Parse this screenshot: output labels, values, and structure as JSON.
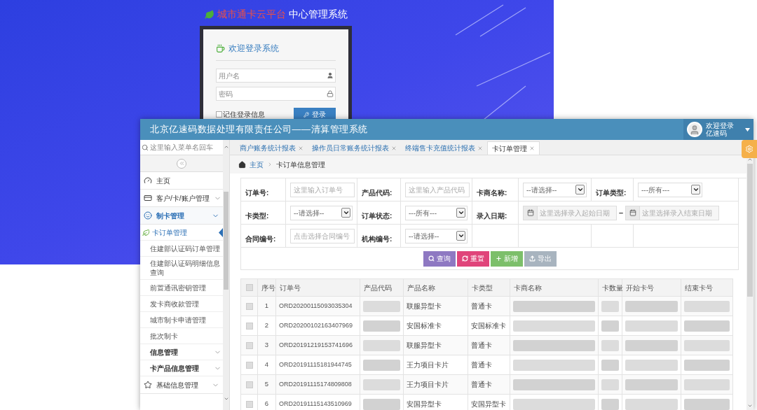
{
  "login_screen": {
    "brand": "城市通卡云平台",
    "system_name": "中心管理系统",
    "card_title": "欢迎登录系统",
    "username": {
      "placeholder": "用户名"
    },
    "password": {
      "placeholder": "密码"
    },
    "remember": {
      "label": "记住登录信息",
      "checked": false
    },
    "login_button": "登录"
  },
  "window": {
    "title": "北京亿速码数据处理有限责任公司——清算管理系统",
    "user": {
      "greeting": "欢迎登录",
      "name": "亿速码"
    }
  },
  "sidebar": {
    "search": {
      "placeholder": "这里输入菜单名回车"
    },
    "items": [
      {
        "label": "主页",
        "kind": "link",
        "selected": false
      },
      {
        "label": "客户/卡/账户管理",
        "kind": "group",
        "expanded": false
      },
      {
        "label": "制卡管理",
        "kind": "group",
        "expanded": true,
        "children": [
          {
            "label": "卡订单管理",
            "kind": "link",
            "selected": true
          },
          {
            "label": "住建部认证码订单管理",
            "kind": "link",
            "selected": false
          },
          {
            "label": "住建部认证码明细信息查询",
            "kind": "link",
            "selected": false
          },
          {
            "label": "前置通讯密钥管理",
            "kind": "link",
            "selected": false
          },
          {
            "label": "发卡商收款管理",
            "kind": "link",
            "selected": false
          },
          {
            "label": "城市制卡申请管理",
            "kind": "link",
            "selected": false
          },
          {
            "label": "批次制卡",
            "kind": "link",
            "selected": false
          },
          {
            "label": "信息管理",
            "kind": "group",
            "expanded": false
          },
          {
            "label": "卡产品信息管理",
            "kind": "group",
            "expanded": false
          }
        ]
      },
      {
        "label": "基础信息管理",
        "kind": "group",
        "expanded": false
      }
    ]
  },
  "tabs": [
    {
      "label": "商户账务统计报表",
      "selected": false
    },
    {
      "label": "操作员日常账务统计报表",
      "selected": false
    },
    {
      "label": "终端售卡充值统计报表",
      "selected": false
    },
    {
      "label": "卡订单管理",
      "selected": true
    }
  ],
  "breadcrumb": [
    "主页",
    "卡订单信息管理"
  ],
  "filter_form": {
    "rows": [
      [
        {
          "label": "订单号:",
          "kind": "text",
          "placeholder": "这里输入订单号"
        },
        {
          "label": "产品代码:",
          "kind": "text",
          "placeholder": "这里输入产品代码"
        },
        {
          "label": "卡商名称:",
          "kind": "select",
          "value": "--请选择--"
        },
        {
          "label": "订单类型:",
          "kind": "select",
          "value": "---所有---"
        }
      ],
      [
        {
          "label": "卡类型:",
          "kind": "select",
          "value": "--请选择--"
        },
        {
          "label": "订单状态:",
          "kind": "select",
          "value": "---所有---"
        },
        {
          "label": "录入日期:",
          "kind": "daterange",
          "start_placeholder": "这里选择录入起始日期",
          "separator": "–",
          "end_placeholder": "这里选择录入结束日期"
        }
      ],
      [
        {
          "label": "合同编号:",
          "kind": "text",
          "placeholder": "点击选择合同编号"
        },
        {
          "label": "机构编号:",
          "kind": "select",
          "value": "--请选择--"
        }
      ]
    ],
    "buttons": [
      {
        "label": "查询",
        "kind": "search",
        "disabled": false
      },
      {
        "label": "重置",
        "kind": "reset",
        "disabled": false
      },
      {
        "label": "新增",
        "kind": "add",
        "disabled": false
      },
      {
        "label": "导出",
        "kind": "export",
        "disabled": true
      }
    ]
  },
  "table": {
    "columns": [
      {
        "label": "序号",
        "kind": "number"
      },
      {
        "label": "订单号",
        "kind": "code"
      },
      {
        "label": "产品代码",
        "kind": "redacted"
      },
      {
        "label": "产品名称",
        "kind": "text"
      },
      {
        "label": "卡类型",
        "kind": "text"
      },
      {
        "label": "卡商名称",
        "kind": "redacted"
      },
      {
        "label": "卡数量",
        "kind": "redacted"
      },
      {
        "label": "开始卡号",
        "kind": "redacted"
      },
      {
        "label": "结束卡号",
        "kind": "redacted"
      }
    ],
    "header_checked": false,
    "rows": [
      {
        "checked": false,
        "cells": [
          "1",
          "ORD20200115093035304",
          "",
          "联服异型卡",
          "普通卡",
          "",
          "",
          "",
          ""
        ]
      },
      {
        "checked": false,
        "cells": [
          "2",
          "ORD20200102163407969",
          "",
          "安国标准卡",
          "安国标准卡",
          "",
          "",
          "",
          ""
        ]
      },
      {
        "checked": false,
        "cells": [
          "3",
          "ORD20191219153741696",
          "",
          "联服异型卡",
          "普通卡",
          "",
          "",
          "",
          ""
        ]
      },
      {
        "checked": false,
        "cells": [
          "4",
          "ORD20191115181944745",
          "",
          "王力项目卡片",
          "普通卡",
          "",
          "",
          "",
          ""
        ]
      },
      {
        "checked": false,
        "cells": [
          "5",
          "ORD20191115174809808",
          "",
          "王力项目卡片",
          "普通卡",
          "",
          "",
          "",
          ""
        ]
      },
      {
        "checked": false,
        "cells": [
          "6",
          "ORD20191115143510969",
          "",
          "安国异型卡",
          "安国异型卡",
          "",
          "",
          "",
          ""
        ]
      }
    ]
  }
}
